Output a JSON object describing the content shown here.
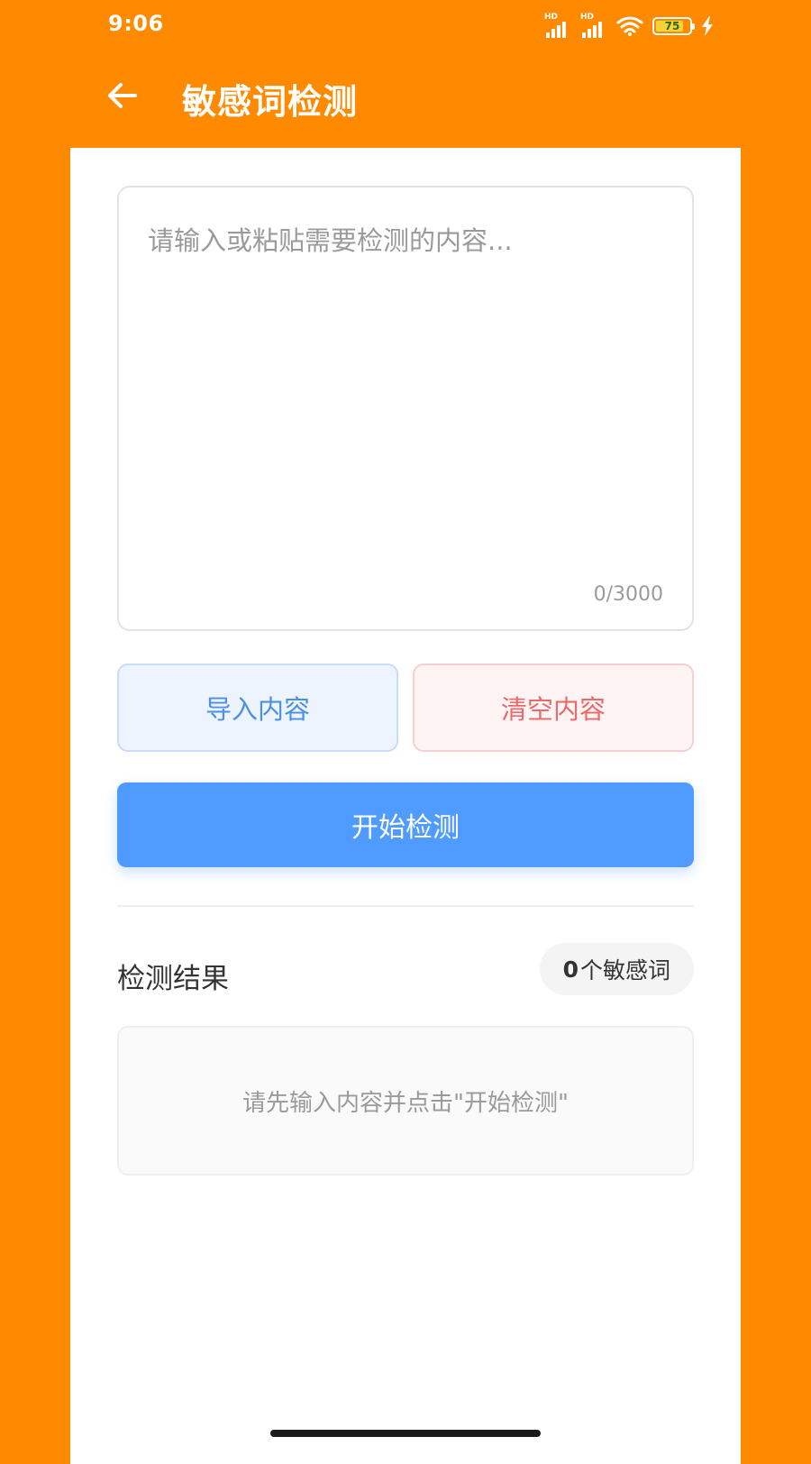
{
  "status_bar": {
    "time": "9:06",
    "signal_1_label": "HD",
    "signal_2_label": "HD",
    "battery_level": "75"
  },
  "app_bar": {
    "title": "敏感词检测",
    "back_icon": "arrow-left-icon"
  },
  "editor": {
    "placeholder": "请输入或粘贴需要检测的内容...",
    "value": "",
    "char_count": "0/3000"
  },
  "actions": {
    "import_label": "导入内容",
    "clear_label": "清空内容",
    "start_label": "开始检测"
  },
  "result": {
    "title": "检测结果",
    "count": "0",
    "count_suffix": "个敏感词",
    "empty_message": "请先输入内容并点击\"开始检测\""
  },
  "colors": {
    "brand_orange": "#FF8A00",
    "primary_blue": "#4F9BFF",
    "import_text": "#4A90E8",
    "clear_text": "#EE6A6A"
  }
}
